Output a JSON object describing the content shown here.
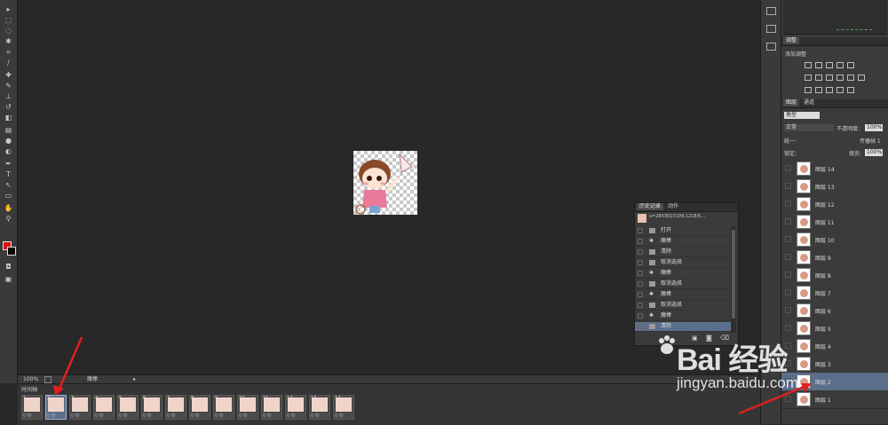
{
  "canvas": {
    "zoom": "100%"
  },
  "statusbar": {
    "zoom": "100%",
    "doc_label": "魔棒"
  },
  "timeline": {
    "title": "时间轴",
    "frames": [
      {
        "num": "1",
        "dur": "0 秒"
      },
      {
        "num": "2",
        "dur": "0 秒"
      },
      {
        "num": "3",
        "dur": "0 秒"
      },
      {
        "num": "4",
        "dur": "0 秒"
      },
      {
        "num": "5",
        "dur": "0 秒"
      },
      {
        "num": "6",
        "dur": "0 秒"
      },
      {
        "num": "7",
        "dur": "0 秒"
      },
      {
        "num": "8",
        "dur": "0 秒"
      },
      {
        "num": "9",
        "dur": "0 秒"
      },
      {
        "num": "10",
        "dur": "0 秒"
      },
      {
        "num": "11",
        "dur": "0 秒"
      },
      {
        "num": "12",
        "dur": "0 秒"
      },
      {
        "num": "13",
        "dur": "0 秒"
      },
      {
        "num": "14",
        "dur": "0 秒"
      }
    ],
    "selected_frame": 2
  },
  "adjustments": {
    "tab": "调整",
    "title": "添加调整"
  },
  "layers": {
    "tab_layers": "图层",
    "tab_channels": "通道",
    "kind_filter": "类型",
    "blend_mode": "正常",
    "opacity_label": "不透明度:",
    "opacity_value": "100%",
    "unify_label": "统一:",
    "propagate_label": "传播帧 1",
    "lock_label": "锁定:",
    "fill_label": "填充:",
    "fill_value": "100%",
    "items": [
      {
        "name": "图层 14"
      },
      {
        "name": "图层 13"
      },
      {
        "name": "图层 12"
      },
      {
        "name": "图层 11"
      },
      {
        "name": "图层 10"
      },
      {
        "name": "图层 9"
      },
      {
        "name": "图层 8"
      },
      {
        "name": "图层 7"
      },
      {
        "name": "图层 6"
      },
      {
        "name": "图层 5"
      },
      {
        "name": "图层 4"
      },
      {
        "name": "图层 3"
      },
      {
        "name": "图层 2"
      },
      {
        "name": "图层 1"
      }
    ],
    "selected_layer": "图层 2"
  },
  "history": {
    "tab_history": "历史记录",
    "tab_actions": "动作",
    "snapshot": "u=2653010109,1218/5...",
    "items": [
      {
        "label": "打开",
        "icon": "document"
      },
      {
        "label": "魔棒",
        "icon": "wand"
      },
      {
        "label": "清除",
        "icon": "document"
      },
      {
        "label": "取消选择",
        "icon": "document"
      },
      {
        "label": "魔棒",
        "icon": "wand"
      },
      {
        "label": "取消选择",
        "icon": "document"
      },
      {
        "label": "魔棒",
        "icon": "wand"
      },
      {
        "label": "取消选择",
        "icon": "document"
      },
      {
        "label": "魔棒",
        "icon": "wand"
      },
      {
        "label": "清除",
        "icon": "document"
      }
    ]
  },
  "watermark": {
    "logo": "Bai 经验",
    "url": "jingyan.baidu.com"
  },
  "colors": {
    "foreground": "#e01010",
    "background": "#000000",
    "selection": "#5b6e8a"
  }
}
